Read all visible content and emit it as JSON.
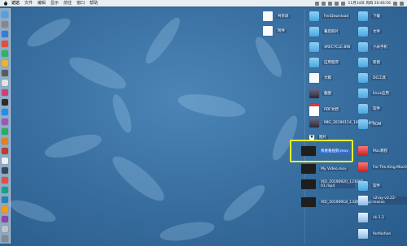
{
  "menubar": {
    "items": [
      "访达",
      "文件",
      "编辑",
      "显示",
      "前往",
      "窗口",
      "帮助"
    ],
    "clock": "11月14日 周四 20:46:56"
  },
  "desktop": {
    "mid_items": [
      {
        "label": "共享屏",
        "icon": "doc"
      },
      {
        "label": "附件",
        "icon": "doc"
      }
    ],
    "col1": [
      {
        "label": "FenDownload",
        "icon": "folder"
      },
      {
        "label": "幕后照片",
        "icon": "folder"
      },
      {
        "label": "$RECYCLE.BIN",
        "icon": "folder"
      },
      {
        "label": "应用程序",
        "icon": "folder"
      },
      {
        "label": "文稿",
        "icon": "doc"
      },
      {
        "label": "截图",
        "icon": "img"
      },
      {
        "label": "PDF文档",
        "icon": "pdf"
      },
      {
        "label": "IMG_20190114_181517.jpg",
        "icon": "img"
      },
      {
        "label": "图片",
        "icon": "folder"
      },
      {
        "label": "青春看视频.mov",
        "icon": "video",
        "selected": true
      },
      {
        "label": "My Video.mov",
        "icon": "video"
      },
      {
        "label": "VID_20190920_121005-01.mp4",
        "icon": "video"
      },
      {
        "label": "VID_20190918_132947.mp4",
        "icon": "video"
      }
    ],
    "col2": [
      {
        "label": "下载",
        "icon": "folder"
      },
      {
        "label": "文件",
        "icon": "folder"
      },
      {
        "label": "小米手机",
        "icon": "folder"
      },
      {
        "label": "新建",
        "icon": "folder"
      },
      {
        "label": "DG工具",
        "icon": "folder"
      },
      {
        "label": "linux应用",
        "icon": "folder"
      },
      {
        "label": "软件",
        "icon": "folder"
      },
      {
        "label": "ADM",
        "icon": "folder"
      },
      {
        "label": "Mac教程",
        "icon": "red"
      },
      {
        "label": "For.The.King.MacOS...VATED",
        "icon": "red"
      },
      {
        "label": "软件",
        "icon": "folder"
      },
      {
        "label": "v2ray-v3.22-macos",
        "icon": "app"
      },
      {
        "label": "ck-1.2",
        "icon": "app"
      },
      {
        "label": "fenfashon",
        "icon": "app"
      }
    ],
    "folder_toggle": "▼"
  }
}
